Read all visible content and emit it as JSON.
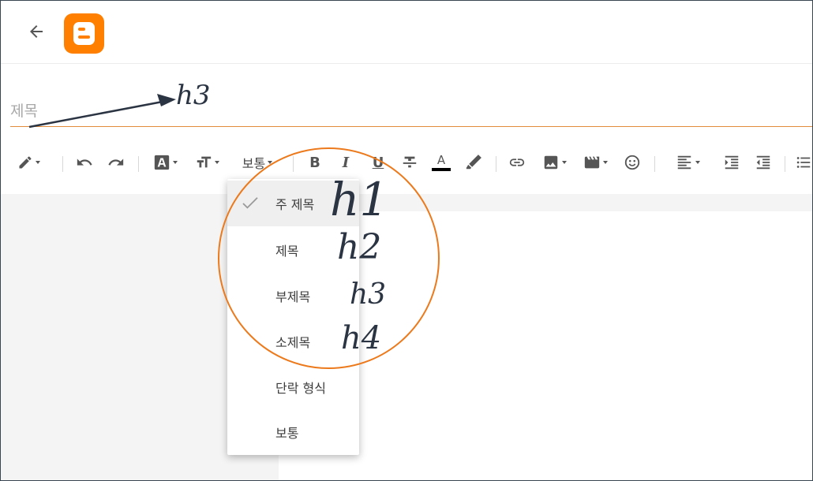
{
  "header": {
    "back_icon": "arrow-left-icon",
    "logo_icon": "blogger-logo-icon",
    "logo_color": "#ff8000"
  },
  "title_field": {
    "placeholder": "제목",
    "value": ""
  },
  "toolbar": {
    "format_label": "보통",
    "items": [
      "pencil-icon",
      "undo-icon",
      "redo-icon",
      "text-style-icon",
      "font-size-icon",
      "bold-icon",
      "italic-icon",
      "underline-icon",
      "strikethrough-icon",
      "text-color-icon",
      "highlight-icon",
      "link-icon",
      "image-icon",
      "video-icon",
      "emoji-icon",
      "align-icon",
      "indent-increase-icon",
      "indent-decrease-icon",
      "list-icon"
    ],
    "bold_glyph": "B",
    "italic_glyph": "I",
    "underline_glyph": "U",
    "text_color_glyph": "A",
    "text_color_bar": "#000000"
  },
  "dropdown": {
    "items": [
      {
        "label": "주 제목",
        "selected": true
      },
      {
        "label": "제목",
        "selected": false
      },
      {
        "label": "부제목",
        "selected": false
      },
      {
        "label": "소제목",
        "selected": false
      },
      {
        "label": "단락 형식",
        "selected": false
      },
      {
        "label": "보통",
        "selected": false
      }
    ]
  },
  "annotations": {
    "arrow_label": "h3",
    "h1": "h1",
    "h2": "h2",
    "h3": "h3",
    "h4": "h4",
    "circle_color": "#ec7a1c",
    "ink_color": "#2b3442"
  }
}
